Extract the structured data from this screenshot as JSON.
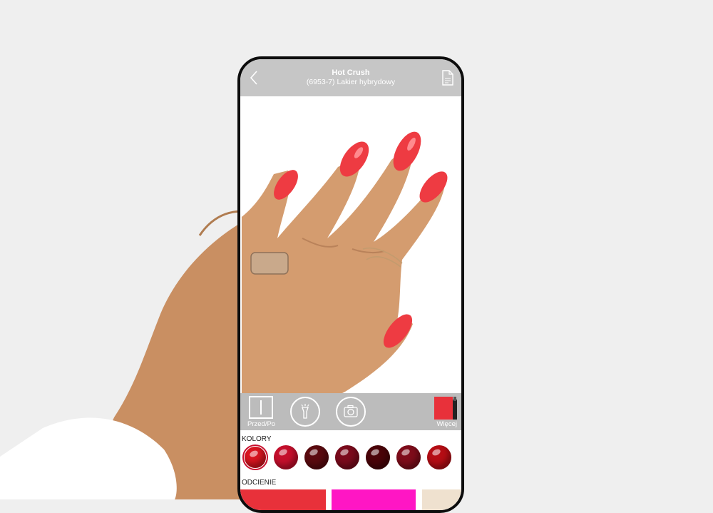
{
  "header": {
    "title": "Hot Crush",
    "subtitle": "(6953-7) Lakier hybrydowy"
  },
  "toolbar": {
    "before_after_label": "Przed/Po",
    "more_label": "Więcej"
  },
  "sections": {
    "colors_label": "KOLORY",
    "shades_label": "ODCIENIE"
  },
  "colors": [
    {
      "hex": "#d9141f",
      "selected": true
    },
    {
      "hex": "#c40f2c",
      "selected": false
    },
    {
      "hex": "#5a0a0f",
      "selected": false
    },
    {
      "hex": "#7a0a1c",
      "selected": false
    },
    {
      "hex": "#4a0308",
      "selected": false
    },
    {
      "hex": "#7e0c1a",
      "selected": false
    },
    {
      "hex": "#b50d14",
      "selected": false
    }
  ],
  "shades": [
    {
      "hex": "#e8313a"
    },
    {
      "hex": "#ff16c4"
    },
    {
      "hex": "#efe1cf"
    }
  ],
  "icons": {
    "back": "chevron-left-icon",
    "document": "document-icon",
    "flash": "flashlight-icon",
    "camera": "camera-icon"
  },
  "accent": "#e8313a"
}
